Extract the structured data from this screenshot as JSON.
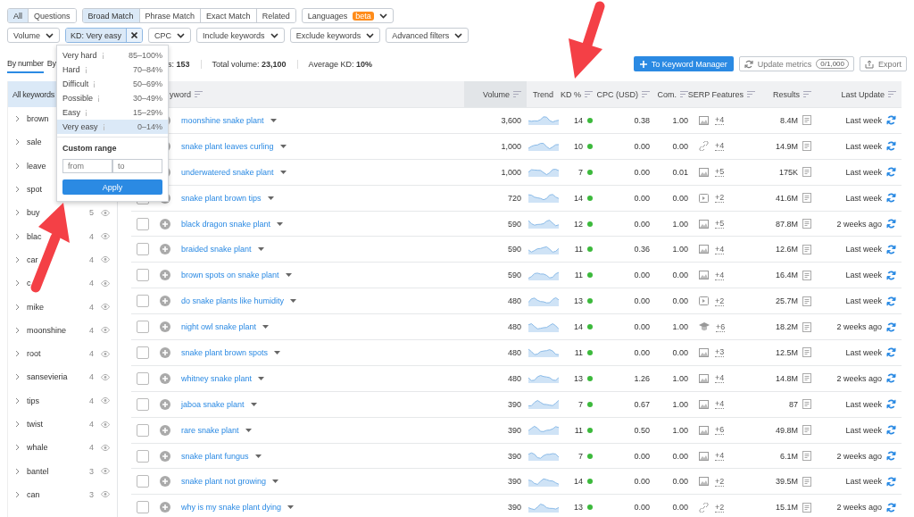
{
  "scope_tabs": [
    {
      "label": "All",
      "selected": true
    },
    {
      "label": "Questions",
      "selected": false
    }
  ],
  "match_tabs": [
    {
      "label": "Broad Match",
      "selected": true
    },
    {
      "label": "Phrase Match",
      "selected": false
    },
    {
      "label": "Exact Match",
      "selected": false
    },
    {
      "label": "Related",
      "selected": false
    }
  ],
  "languages": {
    "label": "Languages",
    "badge": "beta"
  },
  "filters": [
    {
      "label": "Volume",
      "active": false
    },
    {
      "label": "KD: Very easy",
      "active": true
    },
    {
      "label": "CPC",
      "active": false
    },
    {
      "label": "Include keywords",
      "active": false
    },
    {
      "label": "Exclude keywords",
      "active": false
    },
    {
      "label": "Advanced filters",
      "active": false
    }
  ],
  "kd_menu": {
    "options": [
      {
        "label": "Very hard",
        "range": "85–100%",
        "selected": false
      },
      {
        "label": "Hard",
        "range": "70–84%",
        "selected": false
      },
      {
        "label": "Difficult",
        "range": "50–69%",
        "selected": false
      },
      {
        "label": "Possible",
        "range": "30–49%",
        "selected": false
      },
      {
        "label": "Easy",
        "range": "15–29%",
        "selected": false
      },
      {
        "label": "Very easy",
        "range": "0–14%",
        "selected": true
      }
    ],
    "custom_range": "Custom range",
    "from_placeholder": "from",
    "to_placeholder": "to",
    "apply": "Apply"
  },
  "group_tabs": [
    {
      "label": "By number",
      "selected": true
    },
    {
      "label": "By",
      "selected": false
    }
  ],
  "stats": [
    "s: **153**",
    "Total volume: **23,100**",
    "Average KD: **10%**"
  ],
  "actions": {
    "keyword_manager": "To Keyword Manager",
    "update_metrics": "Update metrics",
    "update_quota": "0/1,000",
    "export": "Export"
  },
  "groups": {
    "header": "All keywords",
    "items": [
      {
        "label": "brown"
      },
      {
        "label": "sale"
      },
      {
        "label": "leave"
      },
      {
        "label": "spot"
      },
      {
        "label": "buy",
        "count": "5"
      },
      {
        "label": "blac",
        "count": "4"
      },
      {
        "label": "car",
        "count": "4"
      },
      {
        "label": "c",
        "count": "4"
      },
      {
        "label": "mike",
        "count": "4"
      },
      {
        "label": "moonshine",
        "count": "4"
      },
      {
        "label": "root",
        "count": "4"
      },
      {
        "label": "sansevieria",
        "count": "4"
      },
      {
        "label": "tips",
        "count": "4"
      },
      {
        "label": "twist",
        "count": "4"
      },
      {
        "label": "whale",
        "count": "4"
      },
      {
        "label": "bantel",
        "count": "3"
      },
      {
        "label": "can",
        "count": "3"
      }
    ]
  },
  "table": {
    "columns": [
      "yword",
      "Volume",
      "Trend",
      "KD %",
      "CPC (USD)",
      "Com.",
      "SERP Features",
      "Results",
      "Last Update"
    ],
    "rows": [
      {
        "keyword": "moonshine snake plant",
        "volume": "3,600",
        "kd": "14",
        "cpc": "0.38",
        "com": "1.00",
        "serp": {
          "kind": "image",
          "more": "+4"
        },
        "results": "8.4M",
        "updated": "Last week"
      },
      {
        "keyword": "snake plant leaves curling",
        "volume": "1,000",
        "kd": "10",
        "cpc": "0.00",
        "com": "0.00",
        "serp": {
          "kind": "link",
          "more": "+4"
        },
        "results": "14.9M",
        "updated": "Last week"
      },
      {
        "keyword": "underwatered snake plant",
        "volume": "1,000",
        "kd": "7",
        "cpc": "0.00",
        "com": "0.01",
        "serp": {
          "kind": "image",
          "more": "+5"
        },
        "results": "175K",
        "updated": "Last week"
      },
      {
        "selected": false,
        "keyword": "snake plant brown tips",
        "volume": "720",
        "kd": "14",
        "cpc": "0.00",
        "com": "0.00",
        "serp": {
          "kind": "video",
          "more": "+2"
        },
        "results": "41.6M",
        "updated": "Last week"
      },
      {
        "selected": false,
        "keyword": "black dragon snake plant",
        "volume": "590",
        "kd": "12",
        "cpc": "0.00",
        "com": "1.00",
        "serp": {
          "kind": "image",
          "more": "+5"
        },
        "results": "87.8M",
        "updated": "2 weeks ago"
      },
      {
        "selected": false,
        "keyword": "braided snake plant",
        "volume": "590",
        "kd": "11",
        "cpc": "0.36",
        "com": "1.00",
        "serp": {
          "kind": "image",
          "more": "+4"
        },
        "results": "12.6M",
        "updated": "Last week"
      },
      {
        "selected": false,
        "keyword": "brown spots on snake plant",
        "volume": "590",
        "kd": "11",
        "cpc": "0.00",
        "com": "0.00",
        "serp": {
          "kind": "image",
          "more": "+4"
        },
        "results": "16.4M",
        "updated": "Last week"
      },
      {
        "selected": false,
        "keyword": "do snake plants like humidity",
        "volume": "480",
        "kd": "13",
        "cpc": "0.00",
        "com": "0.00",
        "serp": {
          "kind": "video",
          "more": "+2"
        },
        "results": "25.7M",
        "updated": "Last week"
      },
      {
        "selected": false,
        "keyword": "night owl snake plant",
        "volume": "480",
        "kd": "14",
        "cpc": "0.00",
        "com": "1.00",
        "serp": {
          "kind": "cap",
          "more": "+6"
        },
        "results": "18.2M",
        "updated": "2 weeks ago"
      },
      {
        "selected": false,
        "keyword": "snake plant brown spots",
        "volume": "480",
        "kd": "11",
        "cpc": "0.00",
        "com": "0.00",
        "serp": {
          "kind": "image",
          "more": "+3"
        },
        "results": "12.5M",
        "updated": "Last week"
      },
      {
        "selected": false,
        "keyword": "whitney snake plant",
        "volume": "480",
        "kd": "13",
        "cpc": "1.26",
        "com": "1.00",
        "serp": {
          "kind": "image",
          "more": "+4"
        },
        "results": "14.8M",
        "updated": "2 weeks ago"
      },
      {
        "selected": false,
        "keyword": "jaboa snake plant",
        "volume": "390",
        "kd": "7",
        "cpc": "0.67",
        "com": "1.00",
        "serp": {
          "kind": "image",
          "more": "+4"
        },
        "results": "87",
        "updated": "Last week"
      },
      {
        "selected": false,
        "keyword": "rare snake plant",
        "volume": "390",
        "kd": "11",
        "cpc": "0.50",
        "com": "1.00",
        "serp": {
          "kind": "image",
          "more": "+6"
        },
        "results": "49.8M",
        "updated": "Last week"
      },
      {
        "selected": false,
        "keyword": "snake plant fungus",
        "volume": "390",
        "kd": "7",
        "cpc": "0.00",
        "com": "0.00",
        "serp": {
          "kind": "image",
          "more": "+4"
        },
        "results": "6.1M",
        "updated": "2 weeks ago"
      },
      {
        "selected": false,
        "keyword": "snake plant not growing",
        "volume": "390",
        "kd": "14",
        "cpc": "0.00",
        "com": "0.00",
        "serp": {
          "kind": "image",
          "more": "+2"
        },
        "results": "39.5M",
        "updated": "Last week"
      },
      {
        "selected": false,
        "keyword": "why is my snake plant dying",
        "volume": "390",
        "kd": "13",
        "cpc": "0.00",
        "com": "0.00",
        "serp": {
          "kind": "link",
          "more": "+2"
        },
        "results": "15.1M",
        "updated": "2 weeks ago"
      }
    ]
  }
}
